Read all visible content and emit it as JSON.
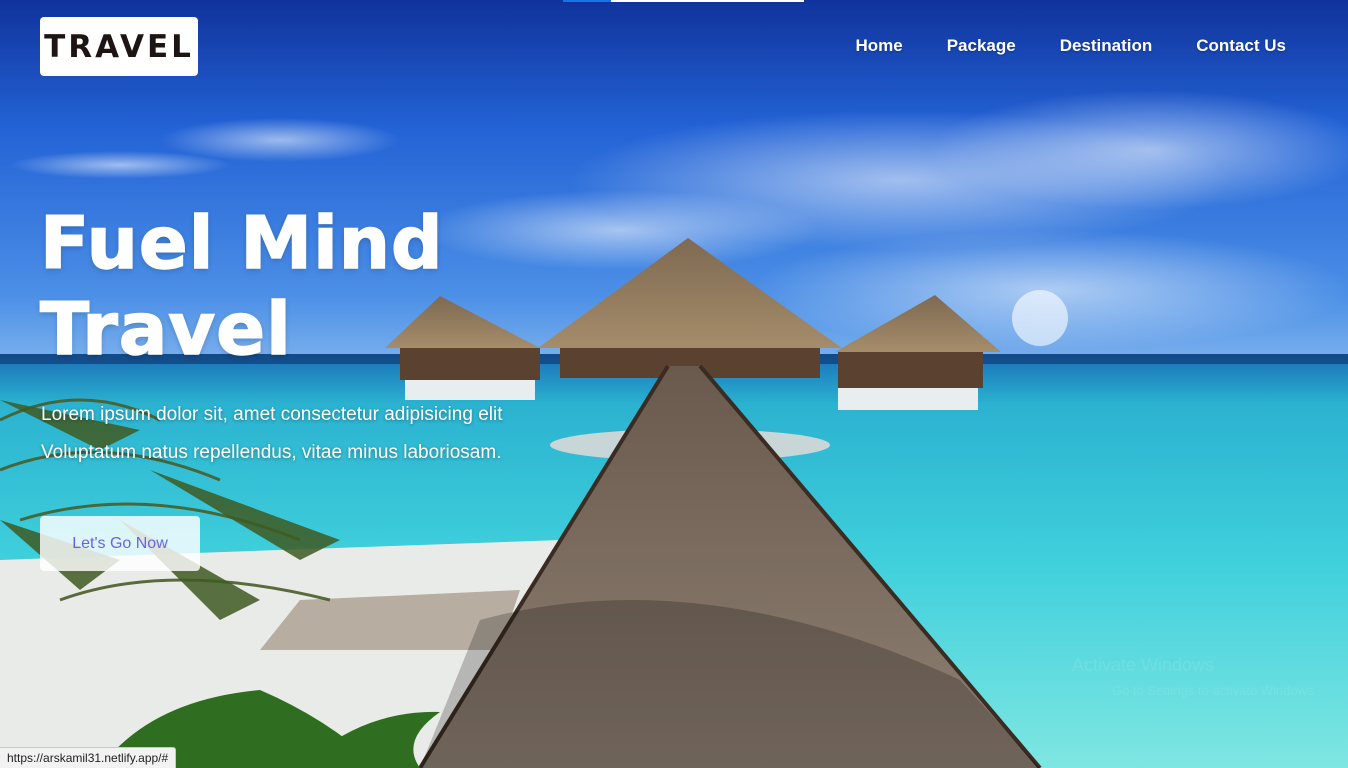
{
  "header": {
    "logo_text": "TRAVEL",
    "nav": [
      {
        "label": "Home"
      },
      {
        "label": "Package"
      },
      {
        "label": "Destination"
      },
      {
        "label": "Contact Us"
      }
    ]
  },
  "hero": {
    "headline_line1": "Fuel Mind",
    "headline_line2": "Travel",
    "subtext_line1": "Lorem ipsum dolor sit, amet consectetur adipisicing elit",
    "subtext_line2": "Voluptatum natus repellendus, vitae minus laboriosam.",
    "cta_label": "Let's Go Now",
    "background_image": "tropical beach with overwater bungalows and wooden pier"
  },
  "page_load_progress": 0.2,
  "watermark": {
    "line1": "Activate Windows",
    "line2": "Go to Settings to activate Windows."
  },
  "status_bar": {
    "url": "https://arskamil31.netlify.app/#"
  },
  "colors": {
    "sky": "#1d52c9",
    "sea": "#38c6d6",
    "cta_text": "#6a63e8",
    "logo_text": "#1d1414"
  }
}
